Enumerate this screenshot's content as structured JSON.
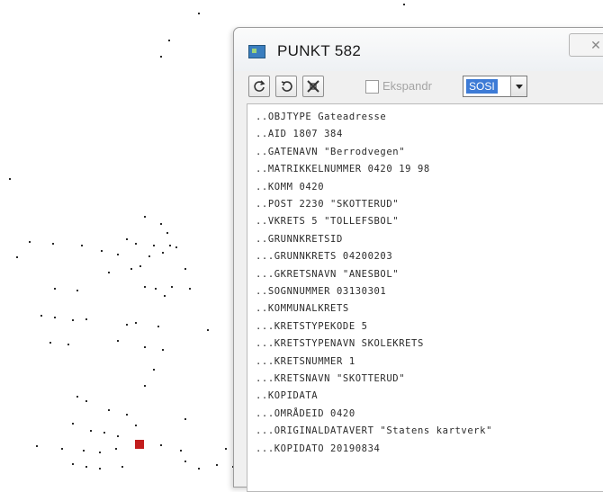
{
  "window": {
    "title": "PUNKT 582",
    "close_glyph": "✕"
  },
  "toolbar": {
    "refresh_icon": "refresh-icon",
    "back_icon": "back-icon",
    "crosshair_icon": "crosshair-icon",
    "expand_label": "Ekspandr",
    "expand_checked": false,
    "format_value": "SOSI"
  },
  "sosi_lines": [
    "..OBJTYPE Gateadresse",
    "..AID 1807 384",
    "..GATENAVN \"Berrodvegen\"",
    "..MATRIKKELNUMMER 0420 19 98",
    "..KOMM 0420",
    "..POST 2230 \"SKOTTERUD\"",
    "..VKRETS 5 \"TOLLEFSBOL\"",
    "..GRUNNKRETSID",
    "...GRUNNKRETS 04200203",
    "...GKRETSNAVN \"ANESBOL\"",
    "..SOGNNUMMER 03130301",
    "..KOMMUNALKRETS",
    "...KRETSTYPEKODE 5",
    "...KRETSTYPENAVN SKOLEKRETS",
    "...KRETSNUMMER 1",
    "...KRETSNAVN \"SKOTTERUD\"",
    "..KOPIDATA",
    "...OMRÅDEID 0420",
    "...ORIGINALDATAVERT \"Statens kartverk\"",
    "...KOPIDATO 20190834"
  ],
  "map": {
    "selected_point_color": "#c21d1d",
    "dot_color": "#2a2a2a"
  }
}
